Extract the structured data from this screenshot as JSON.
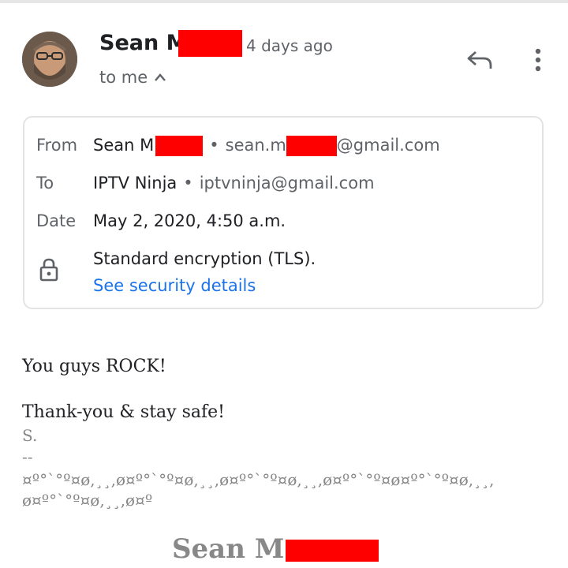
{
  "header": {
    "sender_name": "Sean M",
    "sent_time": "4 days ago",
    "recipient_toggle": "to me",
    "icons": {
      "avatar": "avatar",
      "reply": "reply-icon",
      "more": "more-vert-icon",
      "expand": "chevron-up-icon"
    }
  },
  "details": {
    "from_label": "From",
    "from_name": "Sean M",
    "from_email_prefix": "sean.m",
    "from_email_suffix": "@gmail.com",
    "to_label": "To",
    "to_name": "IPTV Ninja",
    "to_email": "iptvninja@gmail.com",
    "date_label": "Date",
    "date_value": "May 2, 2020, 4:50 a.m.",
    "encryption": "Standard encryption (TLS).",
    "security_link": "See security details",
    "separator": "•",
    "lock_icon": "lock-icon"
  },
  "message": {
    "line1": "You guys ROCK!",
    "line2": "Thank-you & stay safe!",
    "initial": "S.",
    "dashes": "--",
    "ornament1": "¤º°`°º¤ø,¸¸,ø¤º°`°º¤ø,¸¸,ø¤º°`°º¤ø,¸¸,ø¤º°`°º¤ø¤º°`°º¤ø,¸¸,",
    "ornament2": "ø¤º°`°º¤ø,¸¸,ø¤º",
    "signature": "Sean M"
  },
  "colors": {
    "link": "#1a73e8",
    "redaction": "#ff0000",
    "muted": "#5f6368"
  }
}
